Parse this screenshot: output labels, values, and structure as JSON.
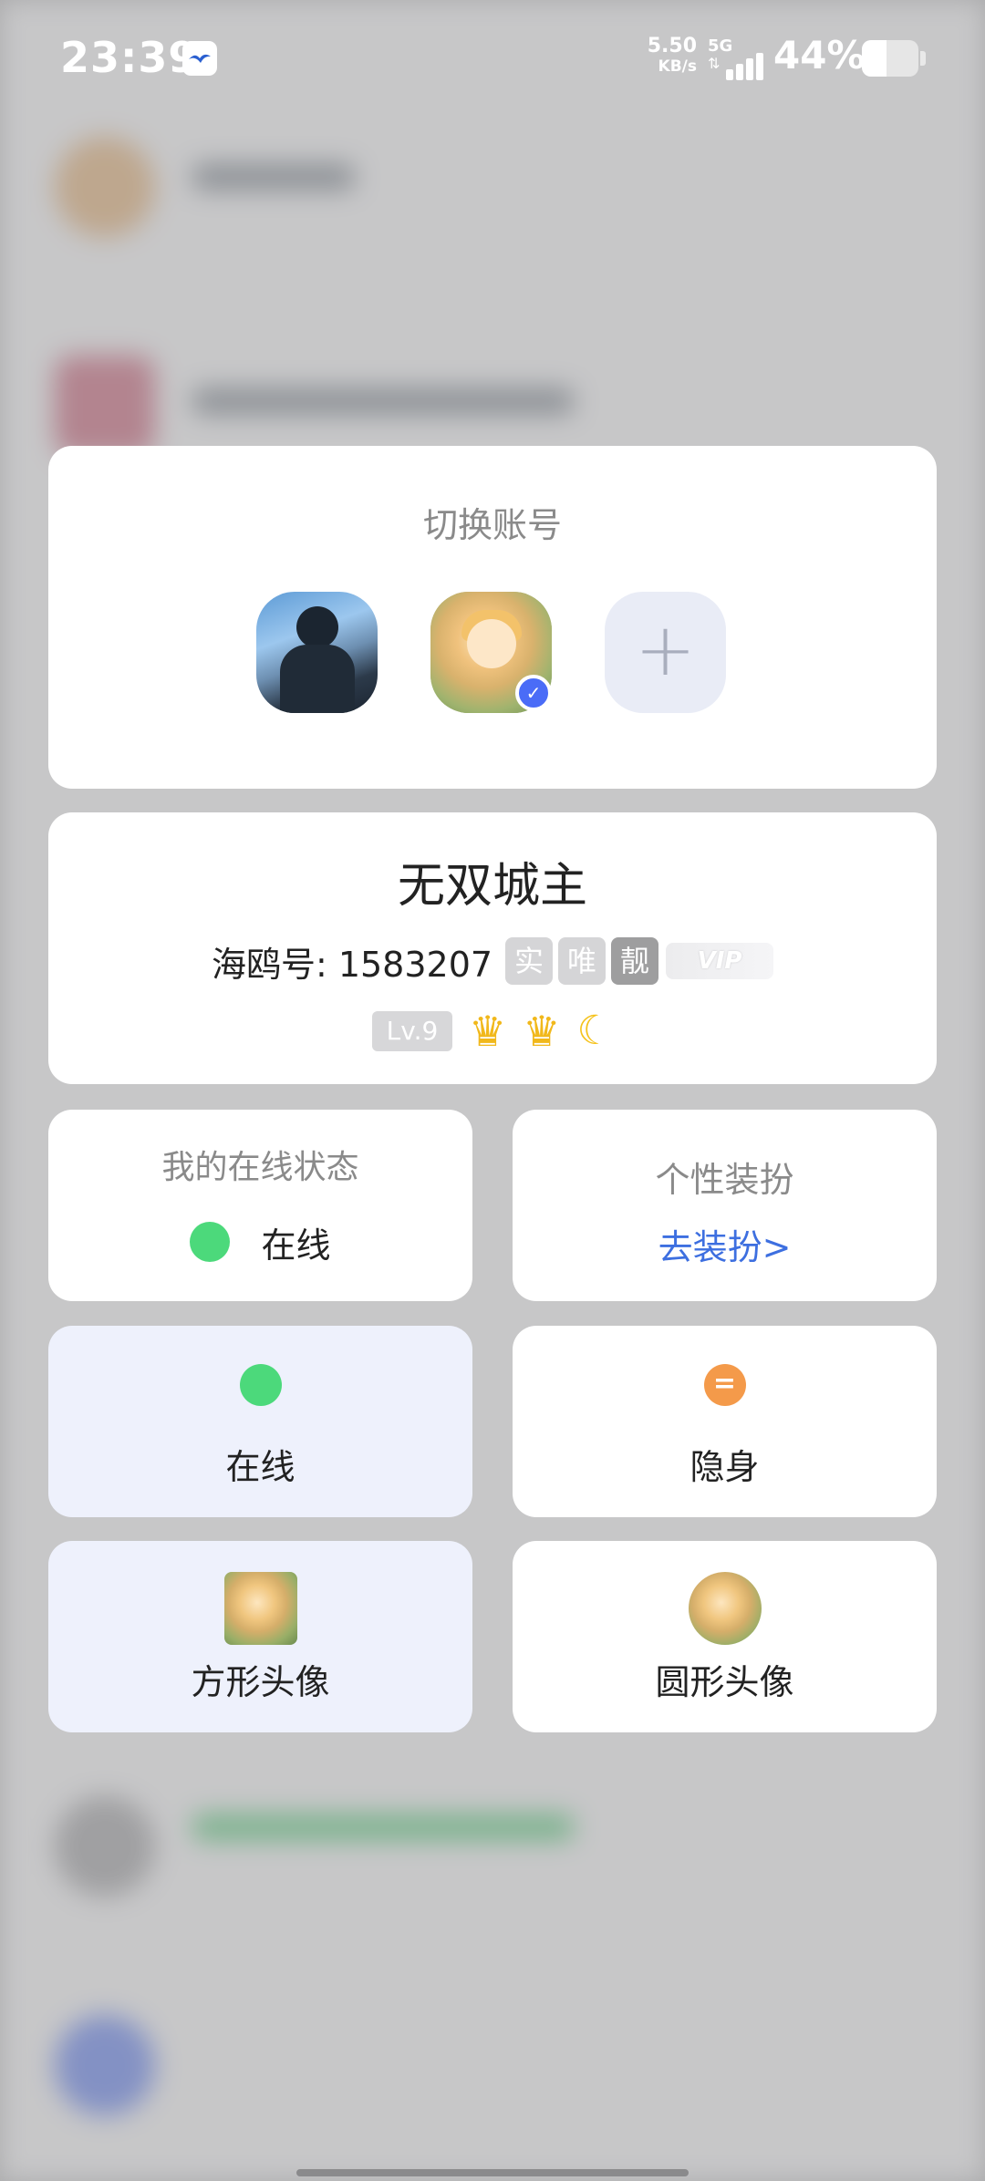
{
  "status_bar": {
    "time": "23:39",
    "app_notification_icon": "seagull-app-icon",
    "net_speed_value": "5.50",
    "net_speed_unit": "KB/s",
    "network": "5G",
    "battery_percent": "44%",
    "battery_level": 0.44
  },
  "switch_account": {
    "title": "切换账号",
    "accounts": [
      {
        "icon": "account-avatar-boy",
        "verified": false
      },
      {
        "icon": "account-avatar-girl",
        "verified": true
      }
    ],
    "add_label": "+"
  },
  "profile": {
    "name": "无双城主",
    "id_text": "海鸥号: 1583207",
    "tags": [
      "实",
      "唯",
      "靓"
    ],
    "vip": "VIP",
    "level": "Lv.9",
    "medals": [
      "crown-medal",
      "crown-medal",
      "moon-medal"
    ]
  },
  "online_status": {
    "title": "我的在线状态",
    "value": "在线",
    "dot_color": "#4cd97b"
  },
  "dress_up": {
    "title": "个性装扮",
    "link": "去装扮>",
    "link_color": "#3d6fe0"
  },
  "options": {
    "online": "在线",
    "invisible": "隐身",
    "invisible_icon": "=",
    "square_avatar": "方形头像",
    "round_avatar": "圆形头像",
    "selected_color": "#eef1fc"
  }
}
